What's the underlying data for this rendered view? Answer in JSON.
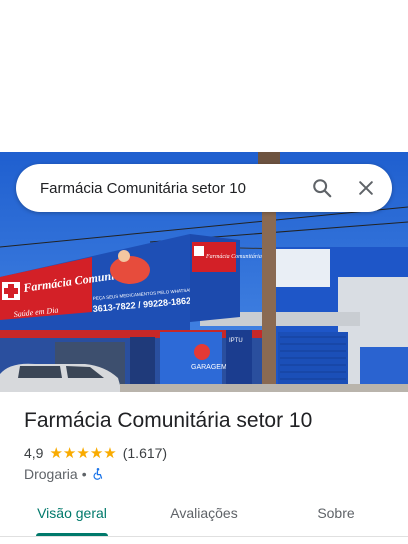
{
  "search": {
    "value": "Farmácia Comunitária setor 10"
  },
  "hero_photo": {
    "sign_brand_left": "Farmácia Comunitária",
    "sign_slogan": "Saúde em Dia",
    "sign_whatsapp_note": "PEÇA SEUS MEDICAMENTOS PELO WHATSAPP!",
    "sign_phones": "3613-7822 / 99228-1862",
    "sign_brand_right": "Farmácia Comunitária",
    "door_label": "GARAGEM",
    "poster_text": "IPTU"
  },
  "place": {
    "title": "Farmácia Comunitária setor 10",
    "rating": "4,9",
    "stars": 5,
    "review_count": "(1.617)",
    "category": "Drogaria",
    "separator": "•"
  },
  "tabs": [
    {
      "label": "Visão geral",
      "active": true
    },
    {
      "label": "Avaliações",
      "active": false
    },
    {
      "label": "Sobre",
      "active": false
    }
  ],
  "colors": {
    "accent": "#00796b",
    "star": "#f9ab00",
    "sign_blue": "#1e4fb5",
    "sign_red": "#d32027",
    "sky": "#2f6fd6"
  }
}
